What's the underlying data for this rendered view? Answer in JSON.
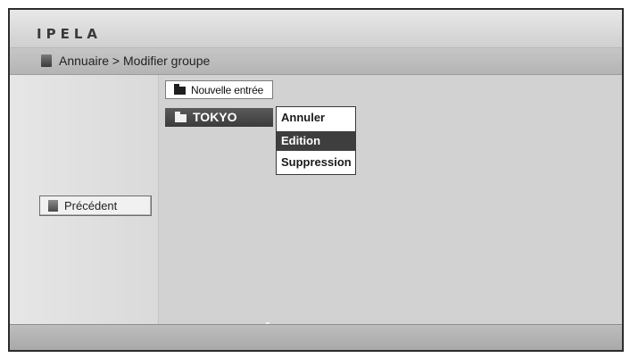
{
  "header": {
    "logo": "IPELA"
  },
  "breadcrumb": {
    "text": "Annuaire > Modifier groupe"
  },
  "sidebar": {
    "back_label": "Précédent"
  },
  "list": {
    "new_entry_label": "Nouvelle entrée",
    "folder_label": "TOKYO"
  },
  "context_menu": {
    "items": [
      {
        "label": "Annuler",
        "selected": false
      },
      {
        "label": "Edition",
        "selected": true
      },
      {
        "label": "Suppression",
        "selected": false
      }
    ]
  }
}
